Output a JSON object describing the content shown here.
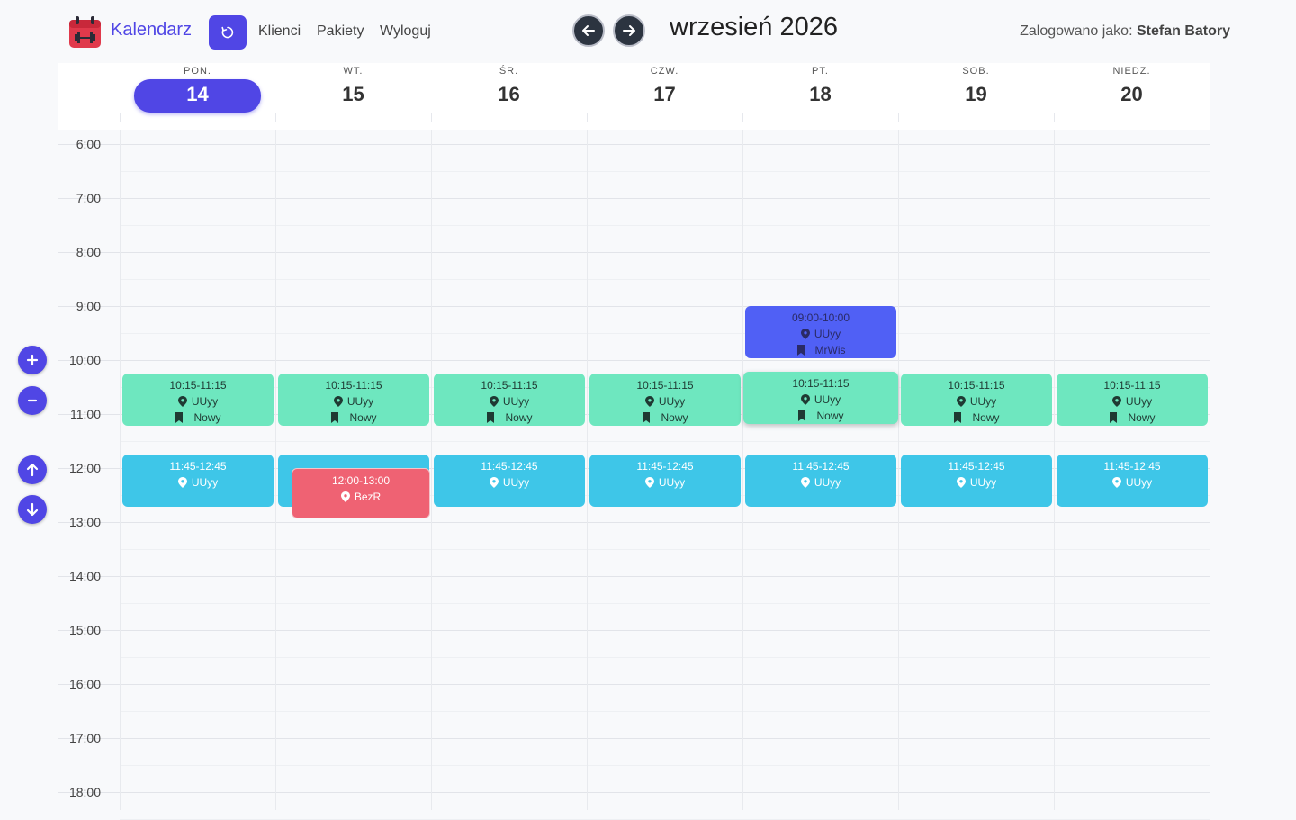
{
  "app": {
    "title": "Kalendarz"
  },
  "nav": {
    "links": [
      "Klienci",
      "Pakiety",
      "Wyloguj"
    ]
  },
  "calendar": {
    "month_title": "wrzesień 2026"
  },
  "user": {
    "label": "Zalogowano jako:",
    "name": "Stefan Batory"
  },
  "days": [
    {
      "name": "PON.",
      "num": "14",
      "selected": true
    },
    {
      "name": "WT.",
      "num": "15",
      "selected": false
    },
    {
      "name": "ŚR.",
      "num": "16",
      "selected": false
    },
    {
      "name": "CZW.",
      "num": "17",
      "selected": false
    },
    {
      "name": "PT.",
      "num": "18",
      "selected": false
    },
    {
      "name": "SOB.",
      "num": "19",
      "selected": false
    },
    {
      "name": "NIEDZ.",
      "num": "20",
      "selected": false
    }
  ],
  "hours": [
    "6:00",
    "7:00",
    "8:00",
    "9:00",
    "10:00",
    "11:00",
    "12:00",
    "13:00",
    "14:00",
    "15:00",
    "16:00",
    "17:00",
    "18:00"
  ],
  "events": [
    {
      "day": 4,
      "start": "09:00",
      "end": "10:00",
      "time": "09:00-10:00",
      "location": "UUyy",
      "tag": "MrWis",
      "color": "blue"
    },
    {
      "day": 0,
      "start": "10:15",
      "end": "11:15",
      "time": "10:15-11:15",
      "location": "UUyy",
      "tag": "Nowy",
      "color": "green"
    },
    {
      "day": 1,
      "start": "10:15",
      "end": "11:15",
      "time": "10:15-11:15",
      "location": "UUyy",
      "tag": "Nowy",
      "color": "green"
    },
    {
      "day": 2,
      "start": "10:15",
      "end": "11:15",
      "time": "10:15-11:15",
      "location": "UUyy",
      "tag": "Nowy",
      "color": "green"
    },
    {
      "day": 3,
      "start": "10:15",
      "end": "11:15",
      "time": "10:15-11:15",
      "location": "UUyy",
      "tag": "Nowy",
      "color": "green"
    },
    {
      "day": 4,
      "start": "10:15",
      "end": "11:15",
      "time": "10:15-11:15",
      "location": "UUyy",
      "tag": "Nowy",
      "color": "green"
    },
    {
      "day": 5,
      "start": "10:15",
      "end": "11:15",
      "time": "10:15-11:15",
      "location": "UUyy",
      "tag": "Nowy",
      "color": "green"
    },
    {
      "day": 6,
      "start": "10:15",
      "end": "11:15",
      "time": "10:15-11:15",
      "location": "UUyy",
      "tag": "Nowy",
      "color": "green"
    },
    {
      "day": 0,
      "start": "11:45",
      "end": "12:45",
      "time": "11:45-12:45",
      "location": "UUyy",
      "color": "cyan"
    },
    {
      "day": 1,
      "start": "11:45",
      "end": "12:45",
      "time": "",
      "location": "",
      "color": "cyan"
    },
    {
      "day": 1,
      "start": "12:00",
      "end": "13:00",
      "time": "12:00-13:00",
      "location": "BezR",
      "color": "red"
    },
    {
      "day": 2,
      "start": "11:45",
      "end": "12:45",
      "time": "11:45-12:45",
      "location": "UUyy",
      "color": "cyan"
    },
    {
      "day": 3,
      "start": "11:45",
      "end": "12:45",
      "time": "11:45-12:45",
      "location": "UUyy",
      "color": "cyan"
    },
    {
      "day": 4,
      "start": "11:45",
      "end": "12:45",
      "time": "11:45-12:45",
      "location": "UUyy",
      "color": "cyan"
    },
    {
      "day": 5,
      "start": "11:45",
      "end": "12:45",
      "time": "11:45-12:45",
      "location": "UUyy",
      "color": "cyan"
    },
    {
      "day": 6,
      "start": "11:45",
      "end": "12:45",
      "time": "11:45-12:45",
      "location": "UUyy",
      "color": "cyan"
    }
  ],
  "colors": {
    "accent": "#5046e5",
    "green": "#6ee7bf",
    "cyan": "#3ec6e8",
    "blue": "#5060f5",
    "red": "#ef6273"
  },
  "side_controls": [
    {
      "name": "zoom-in-button",
      "icon": "plus-icon"
    },
    {
      "name": "zoom-out-button",
      "icon": "minus-icon"
    },
    {
      "name": "scroll-up-button",
      "icon": "arrow-up-icon"
    },
    {
      "name": "scroll-down-button",
      "icon": "arrow-down-icon"
    }
  ]
}
